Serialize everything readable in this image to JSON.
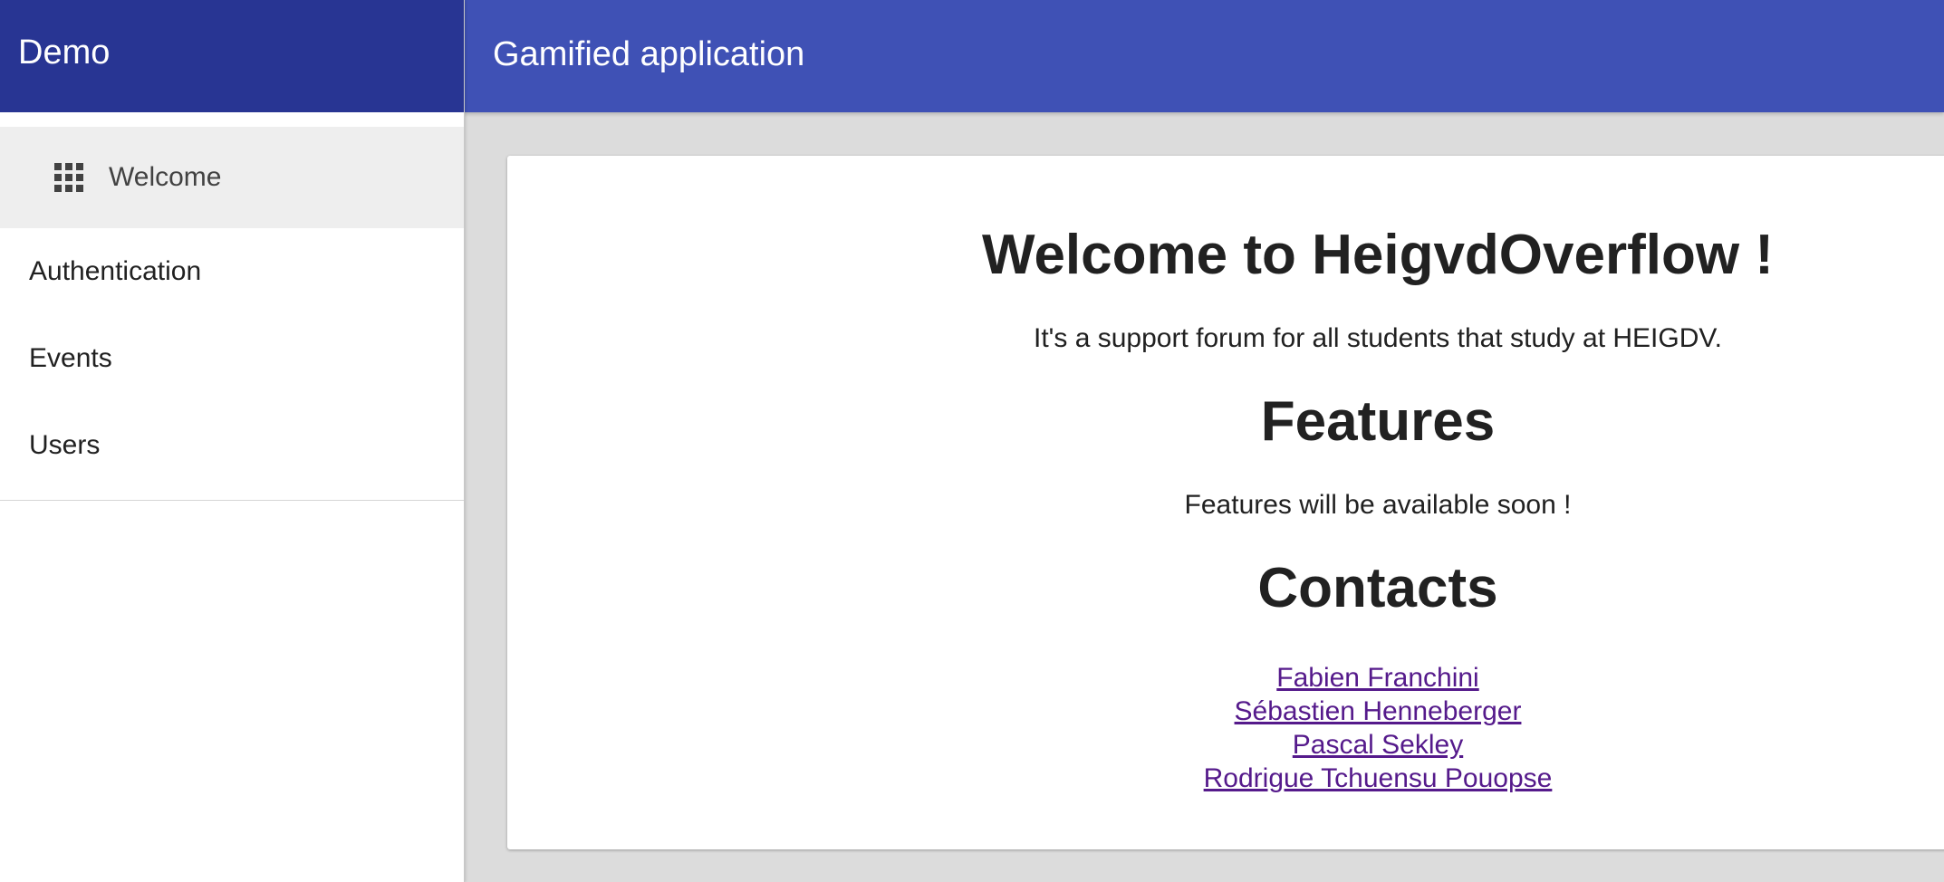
{
  "sidebar": {
    "title": "Demo",
    "items": [
      {
        "label": "Welcome",
        "icon": "apps-grid-icon",
        "active": true
      },
      {
        "label": "Authentication"
      },
      {
        "label": "Events"
      },
      {
        "label": "Users"
      }
    ]
  },
  "topbar": {
    "title": "Gamified application"
  },
  "main": {
    "heading": "Welcome to HeigvdOverflow !",
    "intro": "It's a support forum for all students that study at HEIGDV.",
    "features_heading": "Features",
    "features_text": "Features will be available soon !",
    "contacts_heading": "Contacts",
    "contacts": [
      "Fabien Franchini",
      "Sébastien Henneberger",
      "Pascal Sekley",
      "Rodrigue Tchuensu Pouopse"
    ]
  },
  "colors": {
    "sidebar_header": "#283593",
    "topbar": "#3f51b5",
    "background": "#dcdcdc",
    "link": "#551a8b"
  }
}
